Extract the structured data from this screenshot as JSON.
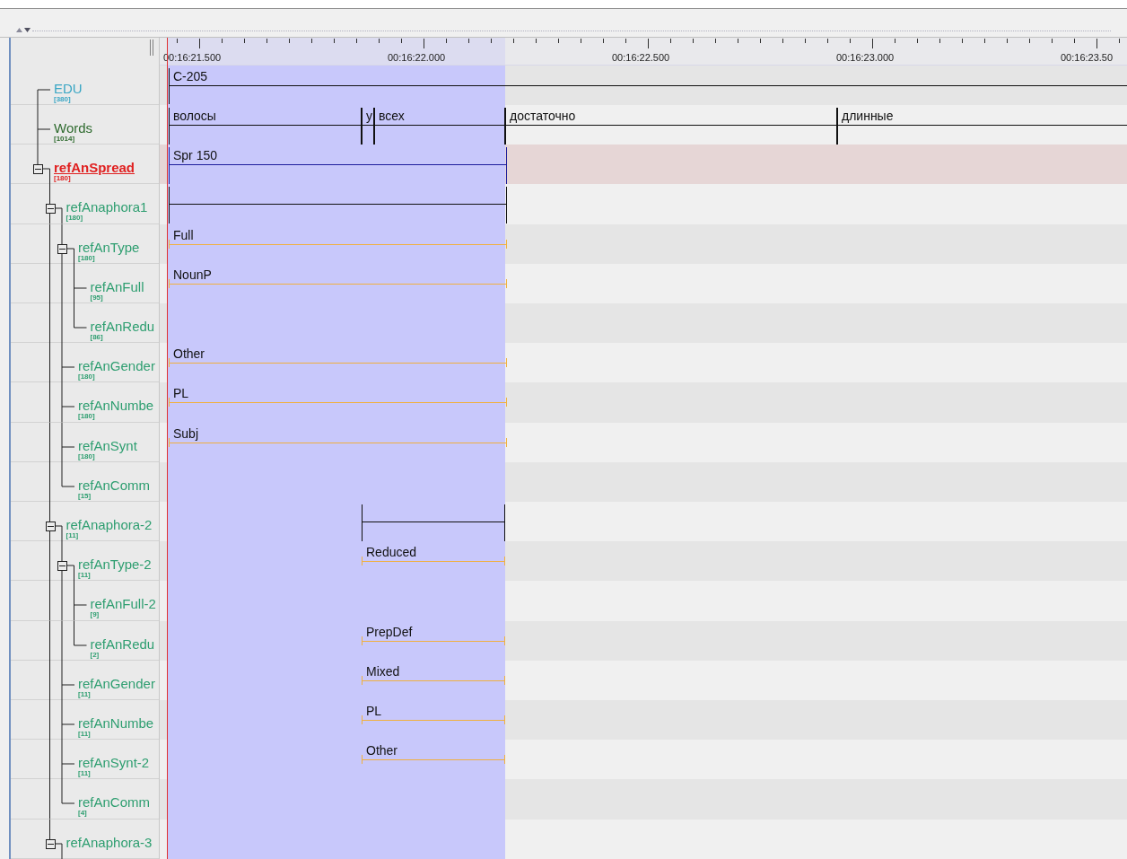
{
  "ruler": {
    "labels": [
      "00:16:21.500",
      "00:16:22.000",
      "00:16:22.500",
      "00:16:23.000",
      "00:16:23.50"
    ]
  },
  "tiers": [
    {
      "name": "EDU",
      "count": "[380]",
      "color": "#3aa6c4",
      "selected": false,
      "annotations": [
        {
          "kind": "labeled",
          "text": "C-205"
        }
      ]
    },
    {
      "name": "Words",
      "count": "[1014]",
      "color": "#2f6b2f",
      "selected": false,
      "annotations": [
        {
          "kind": "labeled",
          "text": "волосы"
        },
        {
          "kind": "labeled",
          "text": "у"
        },
        {
          "kind": "labeled",
          "text": "всех"
        },
        {
          "kind": "labeled",
          "text": "достаточно"
        },
        {
          "kind": "labeled",
          "text": "длинные"
        }
      ]
    },
    {
      "name": "refAnSpread",
      "count": "[180]",
      "color": "#e02020",
      "selected": true,
      "expanded": true,
      "annotations": [
        {
          "kind": "labeled",
          "text": "Spr 150"
        }
      ],
      "children": [
        {
          "name": "refAnaphora1",
          "count": "[180]",
          "color": "#2e9e70",
          "selected": false,
          "expanded": true,
          "annotations": [
            {
              "kind": "blank"
            }
          ],
          "children": [
            {
              "name": "refAnType",
              "count": "[180]",
              "color": "#2e9e70",
              "selected": false,
              "expanded": true,
              "annotations": [
                {
                  "kind": "labeled",
                  "text": "Full"
                }
              ],
              "children": [
                {
                  "name": "refAnFull",
                  "count": "[95]",
                  "color": "#2e9e70",
                  "selected": false,
                  "annotations": [
                    {
                      "kind": "labeled",
                      "text": "NounP"
                    }
                  ]
                },
                {
                  "name": "refAnRedu",
                  "count": "[86]",
                  "color": "#2e9e70",
                  "selected": false
                }
              ]
            },
            {
              "name": "refAnGender",
              "count": "[180]",
              "color": "#2e9e70",
              "selected": false,
              "annotations": [
                {
                  "kind": "labeled",
                  "text": "Other"
                }
              ]
            },
            {
              "name": "refAnNumbe",
              "count": "[180]",
              "color": "#2e9e70",
              "selected": false,
              "annotations": [
                {
                  "kind": "labeled",
                  "text": "PL"
                }
              ]
            },
            {
              "name": "refAnSynt",
              "count": "[180]",
              "color": "#2e9e70",
              "selected": false,
              "annotations": [
                {
                  "kind": "labeled",
                  "text": "Subj"
                }
              ]
            },
            {
              "name": "refAnComm",
              "count": "[15]",
              "color": "#2e9e70",
              "selected": false
            }
          ]
        },
        {
          "name": "refAnaphora-2",
          "count": "[11]",
          "color": "#2e9e70",
          "selected": false,
          "expanded": true,
          "annotations": [
            {
              "kind": "blank"
            }
          ],
          "children": [
            {
              "name": "refAnType-2",
              "count": "[11]",
              "color": "#2e9e70",
              "selected": false,
              "expanded": true,
              "annotations": [
                {
                  "kind": "labeled",
                  "text": "Reduced"
                }
              ],
              "children": [
                {
                  "name": "refAnFull-2",
                  "count": "[9]",
                  "color": "#2e9e70",
                  "selected": false
                },
                {
                  "name": "refAnRedu",
                  "count": "[2]",
                  "color": "#2e9e70",
                  "selected": false,
                  "annotations": [
                    {
                      "kind": "labeled",
                      "text": "PrepDef"
                    }
                  ]
                }
              ]
            },
            {
              "name": "refAnGender",
              "count": "[11]",
              "color": "#2e9e70",
              "selected": false,
              "annotations": [
                {
                  "kind": "labeled",
                  "text": "Mixed"
                }
              ]
            },
            {
              "name": "refAnNumbe",
              "count": "[11]",
              "color": "#2e9e70",
              "selected": false,
              "annotations": [
                {
                  "kind": "labeled",
                  "text": "PL"
                }
              ]
            },
            {
              "name": "refAnSynt-2",
              "count": "[11]",
              "color": "#2e9e70",
              "selected": false,
              "annotations": [
                {
                  "kind": "labeled",
                  "text": "Other"
                }
              ]
            },
            {
              "name": "refAnComm",
              "count": "[4]",
              "color": "#2e9e70",
              "selected": false
            }
          ]
        },
        {
          "name": "refAnaphora-3",
          "color": "#2e9e70",
          "selected": false,
          "expanded": true
        }
      ]
    }
  ]
}
